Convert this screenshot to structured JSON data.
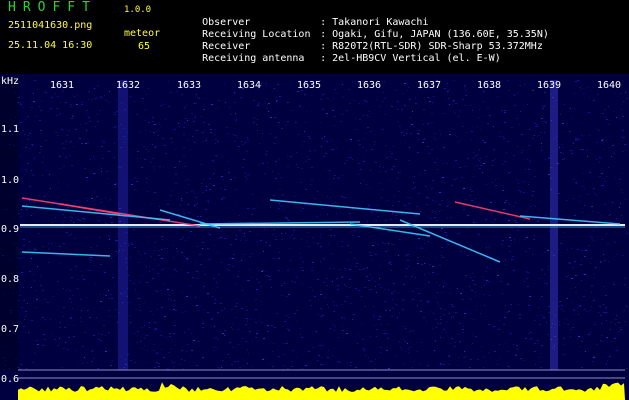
{
  "header": {
    "app_title": "HROFFT",
    "app_version": "1.0.0",
    "file_name": "2511041630.png",
    "timestamp": "25.11.04 16:30",
    "meteor_label": "meteor",
    "meteor_count": "65",
    "info": [
      {
        "key": "Observer",
        "value": ": Takanori Kawachi"
      },
      {
        "key": "Receiving Location",
        "value": ": Ogaki, Gifu, JAPAN (136.60E, 35.35N)"
      },
      {
        "key": "Receiver",
        "value": ": R820T2(RTL-SDR) SDR-Sharp 53.372MHz"
      },
      {
        "key": "Receiving antenna",
        "value": ": 2el-HB9CV Vertical (el. E-W)"
      }
    ]
  },
  "spectrogram": {
    "axis_unit": "kHz",
    "time_ticks": [
      "1631",
      "1632",
      "1633",
      "1634",
      "1635",
      "1636",
      "1637",
      "1638",
      "1639",
      "1640"
    ],
    "freq_ticks": [
      "1.1",
      "1.0",
      "0.9",
      "0.8",
      "0.7",
      "0.6"
    ],
    "colors": {
      "background": "#000040",
      "noise": "#1b1bb0",
      "carrier": "#e8e8ff",
      "echo": "#40c8ff",
      "hot": "#ff4070",
      "level": "#ffff00"
    }
  }
}
